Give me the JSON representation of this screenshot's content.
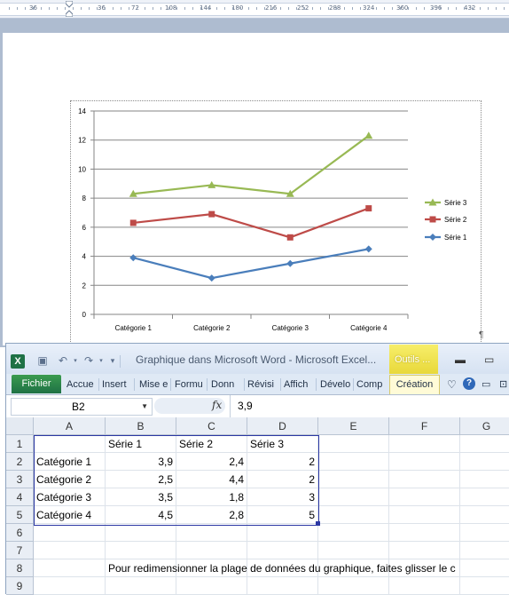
{
  "ruler": {
    "labels": [
      "36",
      "36",
      "72",
      "108",
      "144",
      "180",
      "216",
      "252",
      "288",
      "324",
      "360",
      "396",
      "432"
    ]
  },
  "chart_data": {
    "type": "line",
    "categories": [
      "Catégorie 1",
      "Catégorie 2",
      "Catégorie 3",
      "Catégorie 4"
    ],
    "series": [
      {
        "name": "Série 1",
        "values": [
          3.9,
          2.5,
          3.5,
          4.5
        ],
        "color": "#4a7ebb",
        "marker": "diamond"
      },
      {
        "name": "Série 2",
        "values": [
          6.3,
          6.9,
          5.3,
          7.3
        ],
        "color": "#be4b48",
        "marker": "square"
      },
      {
        "name": "Série 3",
        "values": [
          8.3,
          8.9,
          8.3,
          12.3
        ],
        "color": "#98b954",
        "marker": "triangle"
      }
    ],
    "yticks": [
      "0",
      "2",
      "4",
      "6",
      "8",
      "10",
      "12",
      "14"
    ],
    "ylim": [
      0,
      14
    ],
    "grid": true,
    "legend_position": "right",
    "legend_order": [
      "Série 3",
      "Série 2",
      "Série 1"
    ]
  },
  "excel": {
    "title": "Graphique dans Microsoft Word  -  Microsoft Excel...",
    "outils_label": "Outils ...",
    "tabs": {
      "fichier": "Fichier",
      "accueil": "Accue",
      "insertion": "Insert",
      "mise_en_page": "Mise e",
      "formules": "Formu",
      "donnees": "Donn",
      "revision": "Révisi",
      "affichage": "Affich",
      "developpeur": "Dévelo",
      "compl": "Comp",
      "creation": "Création"
    },
    "namebox": "B2",
    "fx": "fx",
    "formula": "3,9",
    "columns": [
      "A",
      "B",
      "C",
      "D",
      "E",
      "F",
      "G"
    ],
    "rows": [
      "1",
      "2",
      "3",
      "4",
      "5",
      "6",
      "7",
      "8",
      "9"
    ],
    "cells": {
      "r1": [
        "",
        "Série 1",
        "Série 2",
        "Série 3"
      ],
      "r2": [
        "Catégorie 1",
        "3,9",
        "2,4",
        "2"
      ],
      "r3": [
        "Catégorie 2",
        "2,5",
        "4,4",
        "2"
      ],
      "r4": [
        "Catégorie 3",
        "3,5",
        "1,8",
        "3"
      ],
      "r5": [
        "Catégorie 4",
        "4,5",
        "2,8",
        "5"
      ]
    },
    "note": "Pour redimensionner la plage de données du graphique, faites glisser le c"
  },
  "colors": {
    "excel_green": "#1e7145",
    "selection": "#2b37a3",
    "word_bg": "#aebcd0"
  }
}
